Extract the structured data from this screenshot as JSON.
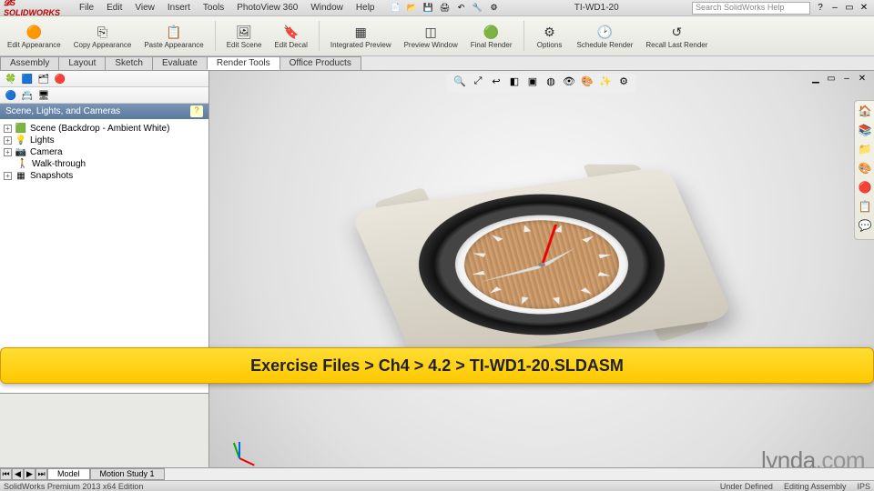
{
  "app": {
    "name": "SOLIDWORKS",
    "doc": "TI-WD1-20",
    "search_placeholder": "Search SolidWorks Help"
  },
  "menus": [
    "File",
    "Edit",
    "View",
    "Insert",
    "Tools",
    "PhotoView 360",
    "Window",
    "Help"
  ],
  "ribbon": [
    {
      "label": "Edit Appearance",
      "icon": "🟠"
    },
    {
      "label": "Copy Appearance",
      "icon": "⎘"
    },
    {
      "label": "Paste Appearance",
      "icon": "📋"
    },
    {
      "label": "Edit Scene",
      "icon": "🖼"
    },
    {
      "label": "Edit Decal",
      "icon": "🔖"
    },
    {
      "label": "Integrated Preview",
      "icon": "▦"
    },
    {
      "label": "Preview Window",
      "icon": "◫"
    },
    {
      "label": "Final Render",
      "icon": "🟢"
    },
    {
      "label": "Options",
      "icon": "⚙"
    },
    {
      "label": "Schedule Render",
      "icon": "🕑"
    },
    {
      "label": "Recall Last Render",
      "icon": "↺"
    }
  ],
  "tabs": [
    "Assembly",
    "Layout",
    "Sketch",
    "Evaluate",
    "Render Tools",
    "Office Products"
  ],
  "active_tab": "Render Tools",
  "side": {
    "header": "Scene, Lights, and Cameras",
    "nodes": [
      {
        "icon": "🟩",
        "label": "Scene (Backdrop - Ambient White)"
      },
      {
        "icon": "💡",
        "label": "Lights"
      },
      {
        "icon": "📷",
        "label": "Camera"
      },
      {
        "icon": "🚶",
        "label": "Walk-through"
      },
      {
        "icon": "▦",
        "label": "Snapshots"
      }
    ]
  },
  "bottom_tabs": [
    "Model",
    "Motion Study 1"
  ],
  "status": {
    "left": "SolidWorks Premium 2013 x64 Edition",
    "under": "Under Defined",
    "mode": "Editing Assembly",
    "units": "IPS"
  },
  "banner": "Exercise Files > Ch4 > 4.2 > TI-WD1-20.SLDASM",
  "watermark": {
    "a": "lynda",
    "b": ".com"
  }
}
